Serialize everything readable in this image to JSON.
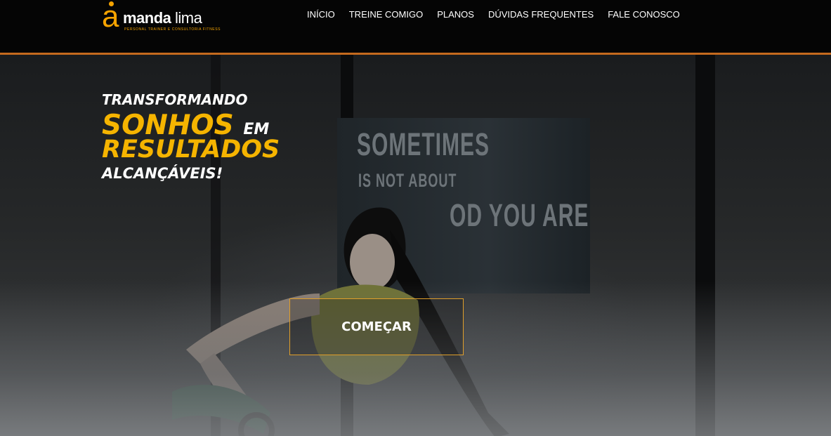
{
  "brand": {
    "logo_initial": "a",
    "logo_name_bold": "manda",
    "logo_name_light": " lima",
    "tagline": "PERSONAL TRAINER E CONSULTORIA FITNESS",
    "accent_color": "#f5a300",
    "divider_color": "#c46a1e"
  },
  "nav": {
    "items": [
      {
        "label": "INÍCIO"
      },
      {
        "label": "TREINE COMIGO"
      },
      {
        "label": "PLANOS"
      },
      {
        "label": "DÚVIDAS FREQUENTES"
      },
      {
        "label": "FALE CONOSCO"
      }
    ]
  },
  "hero": {
    "line1": "TRANSFORMANDO",
    "line2_highlight": "SONHOS",
    "line2_rest": "EM",
    "line3": "RESULTADOS",
    "line4": "ALCANÇÁVEIS!",
    "cta_label": "COMEÇAR",
    "wall_text": [
      "SOMETIMES",
      "IS NOT ABOUT",
      "OD YOU ARE"
    ]
  }
}
